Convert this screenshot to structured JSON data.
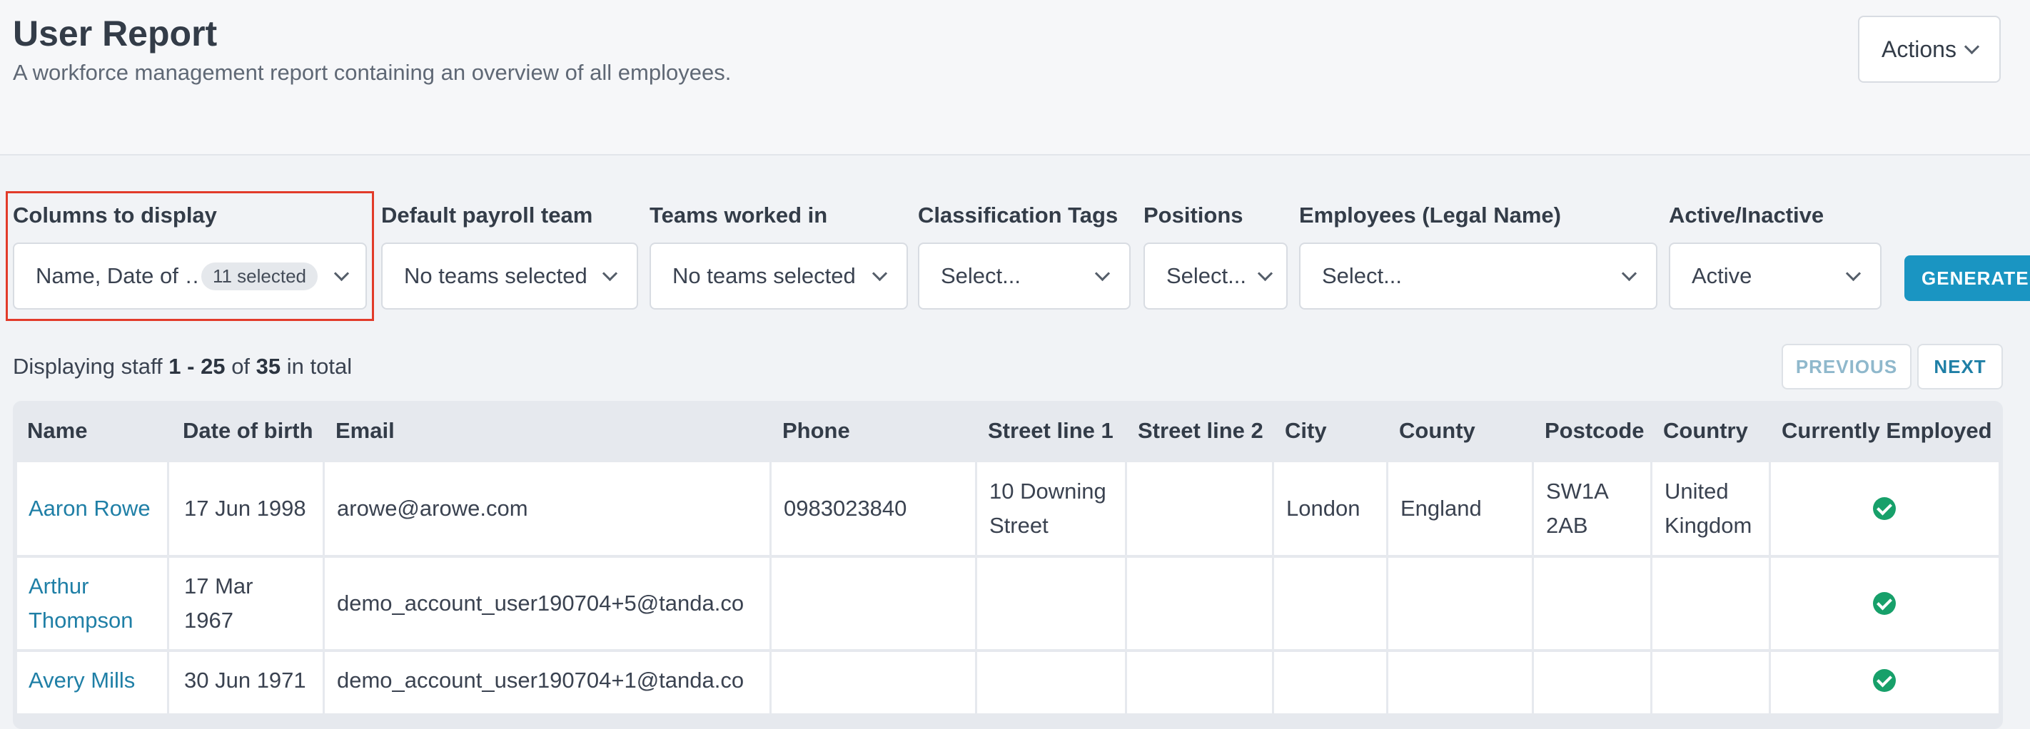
{
  "header": {
    "title": "User Report",
    "subtitle": "A workforce management report containing an overview of all employees.",
    "actions_label": "Actions"
  },
  "filters": {
    "columns": {
      "label": "Columns to display",
      "value": "Name, Date of …",
      "badge": "11 selected"
    },
    "payroll_team": {
      "label": "Default payroll team",
      "value": "No teams selected"
    },
    "teams_worked": {
      "label": "Teams worked in",
      "value": "No teams selected"
    },
    "classification": {
      "label": "Classification Tags",
      "value": "Select..."
    },
    "positions": {
      "label": "Positions",
      "value": "Select..."
    },
    "employees": {
      "label": "Employees (Legal Name)",
      "value": "Select..."
    },
    "active": {
      "label": "Active/Inactive",
      "value": "Active"
    },
    "generate_label": "GENERATE"
  },
  "pagination": {
    "prefix": "Displaying staff",
    "range": "1 - 25",
    "of": "of",
    "total": "35",
    "suffix": "in total",
    "previous_label": "PREVIOUS",
    "next_label": "NEXT"
  },
  "table": {
    "headers": [
      "Name",
      "Date of birth",
      "Email",
      "Phone",
      "Street line 1",
      "Street line 2",
      "City",
      "County",
      "Postcode",
      "Country",
      "Currently Employed"
    ],
    "rows": [
      {
        "name": "Aaron Rowe",
        "dob": "17 Jun 1998",
        "email": "arowe@arowe.com",
        "phone": "0983023840",
        "street1": "10 Downing Street",
        "street2": "",
        "city": "London",
        "county": "England",
        "postcode": "SW1A 2AB",
        "country": "United Kingdom",
        "employed": "check-circle-icon"
      },
      {
        "name": "Arthur Thompson",
        "dob": "17 Mar 1967",
        "email": "demo_account_user190704+5@tanda.co",
        "phone": "",
        "street1": "",
        "street2": "",
        "city": "",
        "county": "",
        "postcode": "",
        "country": "",
        "employed": "check-circle-icon"
      },
      {
        "name": "Avery Mills",
        "dob": "30 Jun 1971",
        "email": "demo_account_user190704+1@tanda.co",
        "phone": "",
        "street1": "",
        "street2": "",
        "city": "",
        "county": "",
        "postcode": "",
        "country": "",
        "employed": "check-circle-icon"
      }
    ]
  },
  "colors": {
    "accent": "#1a95c2",
    "link": "#1f7fa6",
    "success": "#17a06a",
    "highlight": "#e23b2a"
  }
}
